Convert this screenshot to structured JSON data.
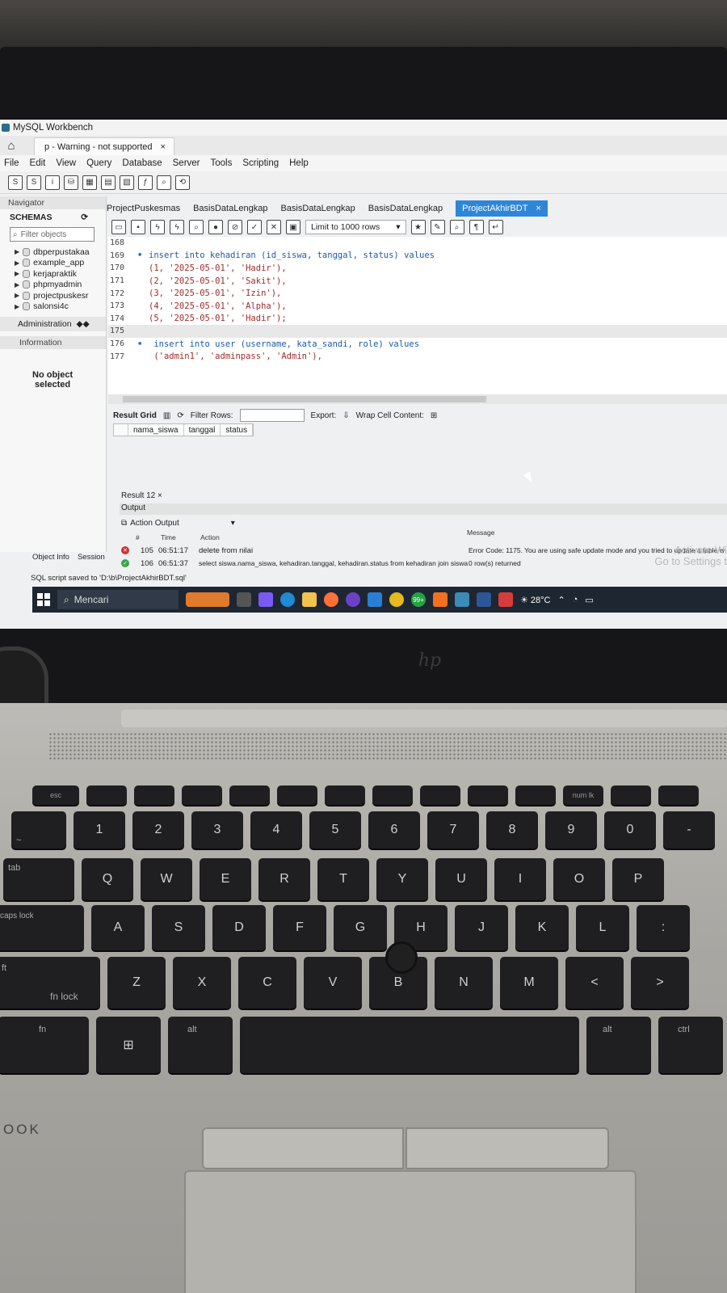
{
  "window": {
    "title": "MySQL Workbench"
  },
  "connection_tab": {
    "label": "p - Warning - not supported",
    "close": "×"
  },
  "menu": [
    "File",
    "Edit",
    "View",
    "Query",
    "Database",
    "Server",
    "Tools",
    "Scripting",
    "Help"
  ],
  "navigator": {
    "header": "Navigator",
    "schemas_label": "SCHEMAS",
    "filter_placeholder": "Filter objects",
    "schemas": [
      "dbperpustakaa",
      "example_app",
      "kerjapraktik",
      "phpmyadmin",
      "projectpuskesr",
      "salonsi4c"
    ],
    "administration": "Administration",
    "information": "Information",
    "no_object_line1": "No object",
    "no_object_line2": "selected",
    "tabs": [
      "Object Info",
      "Session"
    ]
  },
  "editor_tabs": [
    {
      "label": "ProjectPuskesmas",
      "active": false
    },
    {
      "label": "BasisDataLengkap",
      "active": false
    },
    {
      "label": "BasisDataLengkap",
      "active": false
    },
    {
      "label": "BasisDataLengkap",
      "active": false
    },
    {
      "label": "ProjectAkhirBDT",
      "active": true
    }
  ],
  "sql_toolbar": {
    "limit": "Limit to 1000 rows"
  },
  "code_lines": [
    {
      "num": "168",
      "dot": "",
      "text": ""
    },
    {
      "num": "169",
      "dot": "•",
      "text": "insert into kehadiran (id_siswa, tanggal, status) values"
    },
    {
      "num": "170",
      "dot": "",
      "text": "(1, '2025-05-01', 'Hadir'),"
    },
    {
      "num": "171",
      "dot": "",
      "text": "(2, '2025-05-01', 'Sakit'),"
    },
    {
      "num": "172",
      "dot": "",
      "text": "(3, '2025-05-01', 'Izin'),"
    },
    {
      "num": "173",
      "dot": "",
      "text": "(4, '2025-05-01', 'Alpha'),"
    },
    {
      "num": "174",
      "dot": "",
      "text": "(5, '2025-05-01', 'Hadir');"
    },
    {
      "num": "175",
      "dot": "",
      "text": ""
    },
    {
      "num": "176",
      "dot": "•",
      "text": " insert into user (username, kata_sandi, role) values"
    },
    {
      "num": "177",
      "dot": "",
      "text": " ('admin1', 'adminpass', 'Admin'),"
    }
  ],
  "result_bar": {
    "result_grid": "Result Grid",
    "filter_rows": "Filter Rows:",
    "export": "Export:",
    "wrap": "Wrap Cell Content:"
  },
  "grid_columns": [
    "nama_siswa",
    "tanggal",
    "status"
  ],
  "result_tab": "Result 12 ×",
  "output": {
    "header": "Output",
    "selector": "Action Output",
    "col_num": "#",
    "col_time": "Time",
    "col_action": "Action",
    "col_message": "Message",
    "rows": [
      {
        "status": "error",
        "num": "105",
        "time": "06:51:17",
        "action": "delete from nilai",
        "message": "Error Code: 1175. You are using safe update mode and you tried to update a table w"
      },
      {
        "status": "ok",
        "num": "106",
        "time": "06:51:37",
        "action": "select siswa.nama_siswa, kehadiran.tanggal, kehadiran.status from kehadiran join siswa o...",
        "message": "0 row(s) returned"
      }
    ]
  },
  "watermark": {
    "line1": "Activate Wi",
    "line2": "Go to Settings t"
  },
  "status_bar": "SQL script saved to 'D:\\b\\ProjectAkhirBDT.sql'",
  "taskbar": {
    "search": "Mencari",
    "badge": "99+",
    "temperature": "28°C"
  },
  "keyboard": {
    "fn_row": [
      "esc",
      "",
      "",
      "",
      "",
      "",
      "",
      "",
      "",
      "",
      "",
      "num lk",
      "",
      "",
      ""
    ],
    "num_row": [
      "~",
      "1",
      "2",
      "3",
      "4",
      "5",
      "6",
      "7",
      "8",
      "9",
      "0",
      "-",
      "+"
    ],
    "num_row_top": [
      "",
      "!",
      "@",
      "#",
      "$",
      "%",
      "^",
      "&",
      "*",
      "(",
      ")",
      "",
      ""
    ],
    "q_row": [
      "tab",
      "Q",
      "W",
      "E",
      "R",
      "T",
      "Y",
      "U",
      "I",
      "O",
      "P",
      "{"
    ],
    "a_row": [
      "caps lock",
      "A",
      "S",
      "D",
      "F",
      "G",
      "H",
      "J",
      "K",
      "L",
      ":"
    ],
    "z_row": [
      "ft",
      "Z",
      "X",
      "C",
      "V",
      "B",
      "N",
      "M",
      "<",
      ">",
      "?"
    ],
    "z_sub": "fn lock",
    "bottom_row": [
      "fn",
      "",
      "alt",
      "",
      "alt",
      "ctrl"
    ],
    "brand": "OOK"
  }
}
